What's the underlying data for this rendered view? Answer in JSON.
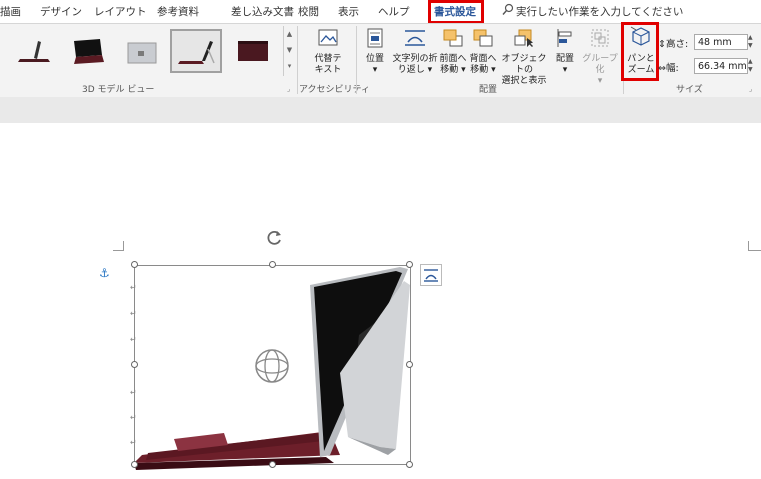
{
  "tabs": [
    "描画",
    "デザイン",
    "レイアウト",
    "参考資料",
    "差し込み文書",
    "校閲",
    "表示",
    "ヘルプ",
    "書式設定"
  ],
  "active_tab": "書式設定",
  "tell_me": {
    "placeholder": "実行したい作業を入力してください"
  },
  "ribbon": {
    "gallery_label": "3D モデル ビュー",
    "accessibility_label": "アクセシビリティ",
    "arrange_label": "配置",
    "size_label": "サイズ",
    "alt_text": "代替テ\nキスト",
    "position": "位置",
    "wrap_text": "文字列の折\nり返し ▾",
    "bring_forward": "前面へ\n移動 ▾",
    "send_backward": "背面へ\n移動 ▾",
    "selection_pane": "オブジェクトの\n選択と表示",
    "align": "配置",
    "group": "グループ化",
    "pan_zoom": "パンと\nズーム",
    "height_label": "高さ:",
    "height_value": "48 mm",
    "width_label": "幅:",
    "width_value": "66.34 mm"
  },
  "colors": {
    "highlight": "#e00000",
    "accent": "#2b579a",
    "keyboard": "#6d1f2a"
  },
  "icons": [
    "search-icon",
    "alt-text-icon",
    "position-icon",
    "wrap-text-icon",
    "bring-forward-icon",
    "send-backward-icon",
    "selection-pane-icon",
    "align-icon",
    "group-icon",
    "pan-zoom-icon",
    "anchor-icon",
    "rotate-icon",
    "3d-rotate-icon",
    "layout-options-icon"
  ]
}
